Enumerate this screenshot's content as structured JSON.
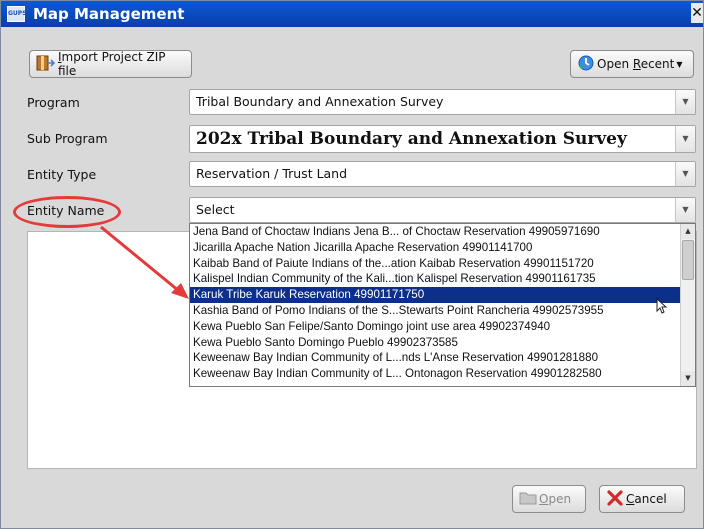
{
  "window": {
    "title": "Map Management",
    "app_icon_text": "GUPS",
    "close_glyph": "✕"
  },
  "toolbar": {
    "import_button": {
      "mnemonic": "I",
      "label_rest": "mport Project ZIP file"
    },
    "open_recent_button": {
      "label_start": "Open ",
      "mnemonic": "R",
      "label_rest": "ecent"
    }
  },
  "form": {
    "program_label": "Program",
    "program_value": "Tribal Boundary and Annexation Survey",
    "sub_program_label": "Sub Program",
    "sub_program_value": "202x Tribal Boundary and Annexation Survey",
    "entity_type_label": "Entity Type",
    "entity_type_value": "Reservation / Trust Land",
    "entity_name_label": "Entity Name",
    "entity_name_value": "Select"
  },
  "dropdown": {
    "items": [
      "Jena Band of Choctaw Indians Jena B... of Choctaw Reservation 49905971690",
      "Jicarilla Apache Nation Jicarilla Apache Reservation 49901141700",
      "Kaibab Band of Paiute Indians of the...ation Kaibab Reservation 49901151720",
      "Kalispel Indian Community of the Kali...tion Kalispel Reservation 49901161735",
      "Karuk Tribe Karuk Reservation 49901171750",
      "Kashia Band of Pomo Indians of the S...Stewarts Point Rancheria 49902573955",
      "Kewa Pueblo San Felipe/Santo Domingo joint use area 49902374940",
      "Kewa Pueblo Santo Domingo Pueblo 49902373585",
      "Keweenaw Bay Indian Community of L...nds L'Anse Reservation 49901281880",
      "Keweenaw Bay Indian Community of L... Ontonagon Reservation 49901282580"
    ],
    "selected_index": 4
  },
  "footer": {
    "open_button": {
      "mnemonic": "O",
      "label_rest": "pen"
    },
    "cancel_button": {
      "mnemonic": "C",
      "label_rest": "ancel"
    }
  },
  "colors": {
    "title_bar": "#0a4cc4",
    "selection": "#0b2f8a",
    "annotation": "#e53a3a"
  },
  "icons": [
    "app-icon",
    "zip-file-icon",
    "open-recent-icon",
    "dropdown-arrow-icon",
    "open-folder-icon",
    "cancel-x-icon",
    "mouse-cursor-icon"
  ]
}
